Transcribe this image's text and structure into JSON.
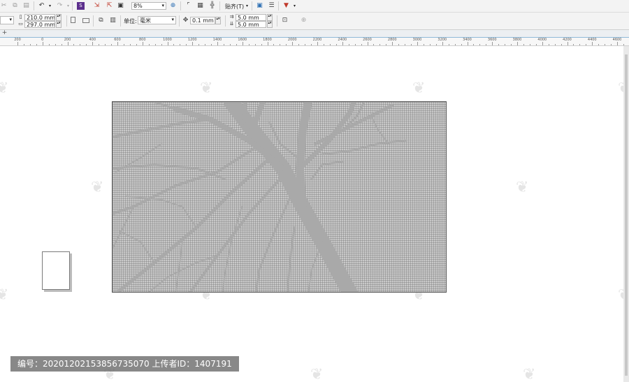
{
  "toolbar_top": {
    "zoom_value": "8%",
    "snap_label": "贴齐(T)"
  },
  "property_bar": {
    "page_width": "210.0 mm",
    "page_height": "297.0 mm",
    "units_label": "单位:",
    "units_value": "毫米",
    "nudge_value": "0.1 mm",
    "dup_x": "5.0 mm",
    "dup_y": "5.0 mm"
  },
  "ruler": {
    "labels": [
      "200",
      "0",
      "200",
      "400",
      "600",
      "800",
      "1000",
      "1200",
      "1400",
      "1600",
      "1800",
      "2000",
      "2200",
      "2400",
      "2600",
      "2800",
      "3000",
      "3200",
      "3400",
      "3600",
      "3800",
      "4000",
      "4200",
      "4400",
      "4600"
    ]
  },
  "watermark": {
    "text": "编号：20201202153856735070 上传者ID：1407191"
  },
  "accent_color": "#8fb9d8",
  "image_fill_color": "#c9c9c9",
  "tree_color": "#a9a9a9"
}
